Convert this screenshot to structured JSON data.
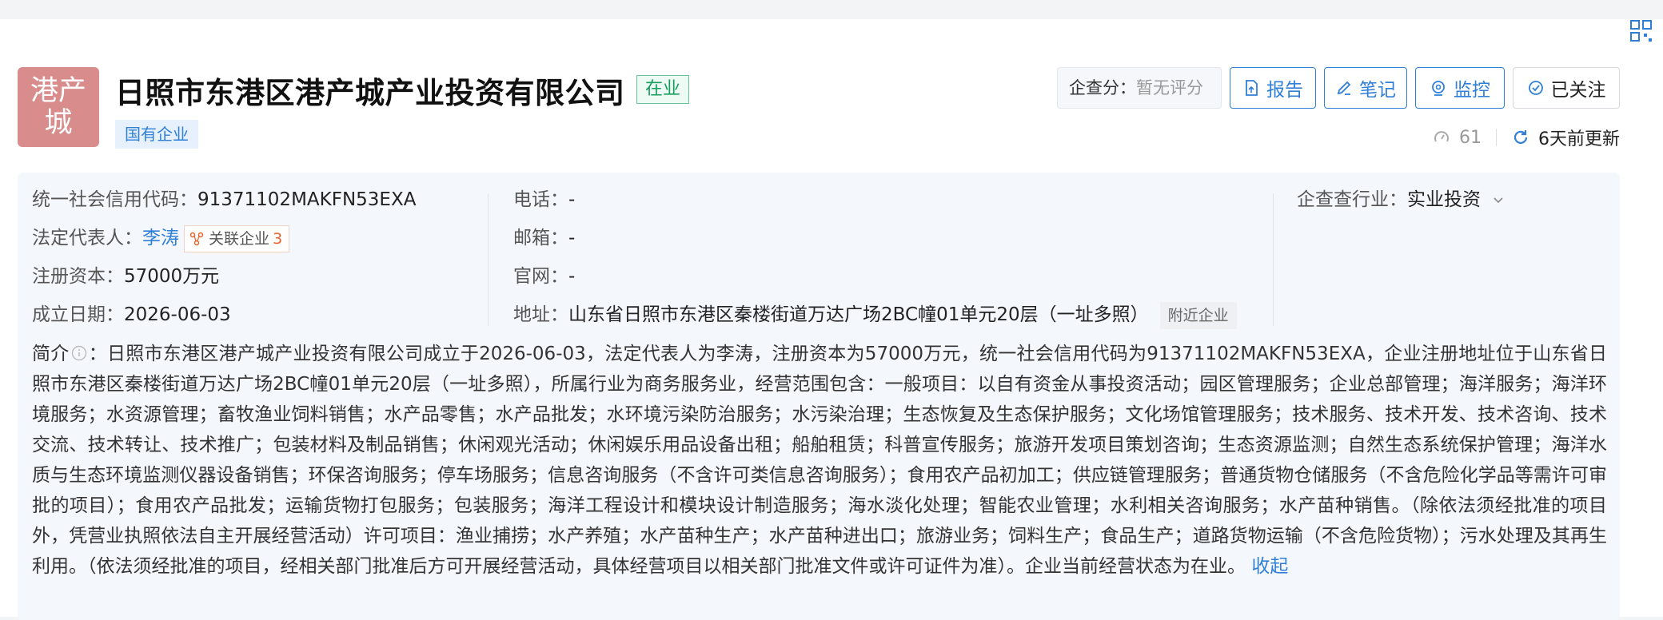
{
  "company": {
    "logo_text": "港产城",
    "name": "日照市东港区港产城产业投资有限公司",
    "status": "在业",
    "tag": "国有企业"
  },
  "header": {
    "score_label": "企查分：",
    "score_value": "暂无评分",
    "report_label": "报告",
    "notes_label": "笔记",
    "monitor_label": "监控",
    "follow_label": "已关注",
    "views": "61",
    "updated": "6天前更新"
  },
  "info": {
    "credit_code_label": "统一社会信用代码：",
    "credit_code": "91371102MAKFN53EXA",
    "legal_rep_label": "法定代表人：",
    "legal_rep": "李涛",
    "related_label": "关联企业",
    "related_count": "3",
    "capital_label": "注册资本：",
    "capital": "57000万元",
    "founded_label": "成立日期：",
    "founded": "2026-06-03",
    "phone_label": "电话：",
    "phone": "-",
    "email_label": "邮箱：",
    "email": "-",
    "website_label": "官网：",
    "website": "-",
    "address_label": "地址：",
    "address": "山东省日照市东港区秦楼街道万达广场2BC幢01单元20层（一址多照）",
    "nearby_label": "附近企业",
    "industry_label": "企查查行业：",
    "industry": "实业投资"
  },
  "intro": {
    "label": "简介",
    "colon": "：",
    "text": "日照市东港区港产城产业投资有限公司成立于2026-06-03，法定代表人为李涛，注册资本为57000万元，统一社会信用代码为91371102MAKFN53EXA，企业注册地址位于山东省日照市东港区秦楼街道万达广场2BC幢01单元20层（一址多照），所属行业为商务服务业，经营范围包含：一般项目：以自有资金从事投资活动；园区管理服务；企业总部管理；海洋服务；海洋环境服务；水资源管理；畜牧渔业饲料销售；水产品零售；水产品批发；水环境污染防治服务；水污染治理；生态恢复及生态保护服务；文化场馆管理服务；技术服务、技术开发、技术咨询、技术交流、技术转让、技术推广；包装材料及制品销售；休闲观光活动；休闲娱乐用品设备出租；船舶租赁；科普宣传服务；旅游开发项目策划咨询；生态资源监测；自然生态系统保护管理；海洋水质与生态环境监测仪器设备销售；环保咨询服务；停车场服务；信息咨询服务（不含许可类信息咨询服务）；食用农产品初加工；供应链管理服务；普通货物仓储服务（不含危险化学品等需许可审批的项目）；食用农产品批发；运输货物打包服务；包装服务；海洋工程设计和模块设计制造服务；海水淡化处理；智能农业管理；水利相关咨询服务；水产苗种销售。（除依法须经批准的项目外，凭营业执照依法自主开展经营活动）许可项目：渔业捕捞；水产养殖；水产苗种生产；水产苗种进出口；旅游业务；饲料生产；食品生产；道路货物运输（不含危险货物）；污水处理及其再生利用。（依法须经批准的项目，经相关部门批准后方可开展经营活动，具体经营项目以相关部门批准文件或许可证件为准）。企业当前经营状态为在业。",
    "collapse": "收起"
  }
}
